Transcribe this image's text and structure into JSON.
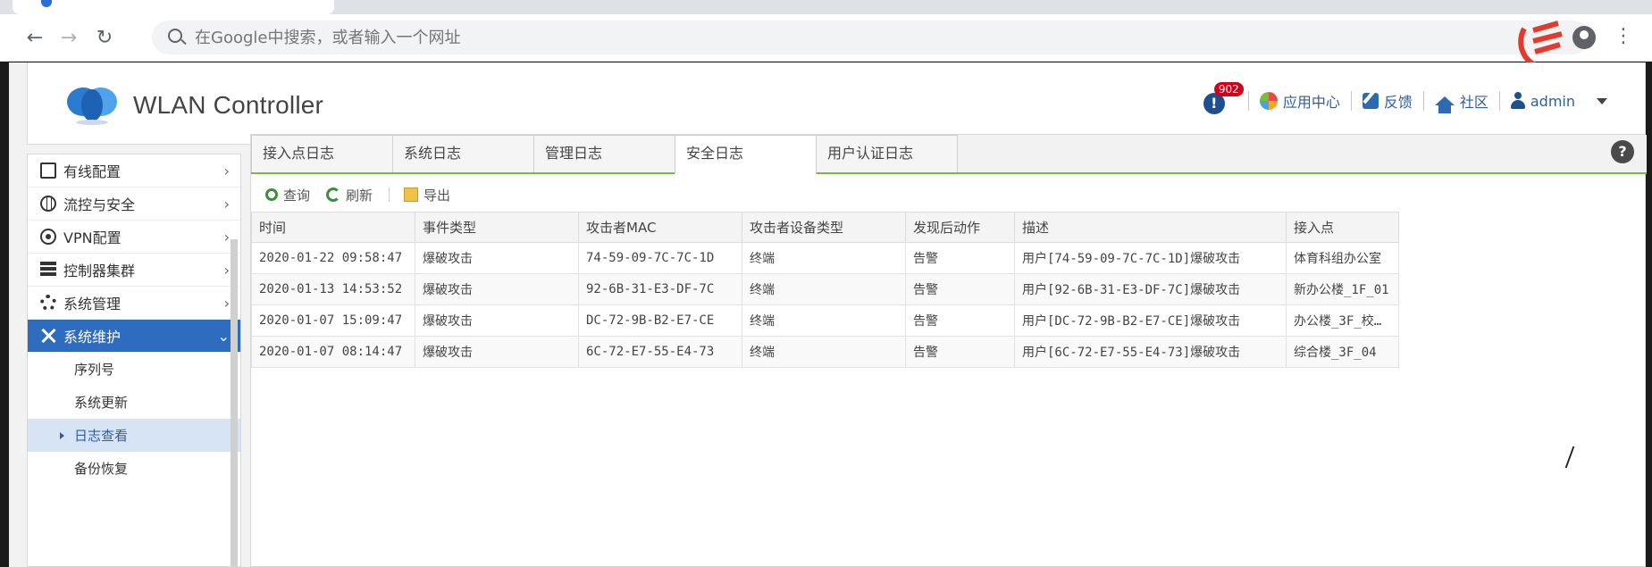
{
  "browser": {
    "address_placeholder": "在Google中搜索，或者输入一个网址"
  },
  "header": {
    "title": "WLAN Controller",
    "alert_count": "902",
    "app_center": "应用中心",
    "feedback": "反馈",
    "community": "社区",
    "user": "admin"
  },
  "sidebar": {
    "items": [
      {
        "label": "有线配置"
      },
      {
        "label": "流控与安全"
      },
      {
        "label": "VPN配置"
      },
      {
        "label": "控制器集群"
      },
      {
        "label": "系统管理"
      },
      {
        "label": "系统维护"
      }
    ],
    "sub_items": [
      {
        "label": "序列号"
      },
      {
        "label": "系统更新"
      },
      {
        "label": "日志查看"
      },
      {
        "label": "备份恢复"
      }
    ]
  },
  "tabs": [
    {
      "label": "接入点日志"
    },
    {
      "label": "系统日志"
    },
    {
      "label": "管理日志"
    },
    {
      "label": "安全日志"
    },
    {
      "label": "用户认证日志"
    }
  ],
  "actions": {
    "query": "查询",
    "refresh": "刷新",
    "export": "导出"
  },
  "table": {
    "columns": [
      "时间",
      "事件类型",
      "攻击者MAC",
      "攻击者设备类型",
      "发现后动作",
      "描述",
      "接入点"
    ],
    "rows": [
      [
        "2020-01-22 09:58:47",
        "爆破攻击",
        "74-59-09-7C-7C-1D",
        "终端",
        "告警",
        "用户[74-59-09-7C-7C-1D]爆破攻击",
        "体育科组办公室"
      ],
      [
        "2020-01-13 14:53:52",
        "爆破攻击",
        "92-6B-31-E3-DF-7C",
        "终端",
        "告警",
        "用户[92-6B-31-E3-DF-7C]爆破攻击",
        "新办公楼_1F_01"
      ],
      [
        "2020-01-07 15:09:47",
        "爆破攻击",
        "DC-72-9B-B2-E7-CE",
        "终端",
        "告警",
        "用户[DC-72-9B-B2-E7-CE]爆破攻击",
        "办公楼_3F_校…"
      ],
      [
        "2020-01-07 08:14:47",
        "爆破攻击",
        "6C-72-E7-55-E4-73",
        "终端",
        "告警",
        "用户[6C-72-E7-55-E4-73]爆破攻击",
        "综合楼_3F_04"
      ]
    ]
  },
  "colors": {
    "sidebar_active": "#2e6cc0",
    "tab_underline": "#7ab648",
    "alert_badge": "#d0021b"
  }
}
